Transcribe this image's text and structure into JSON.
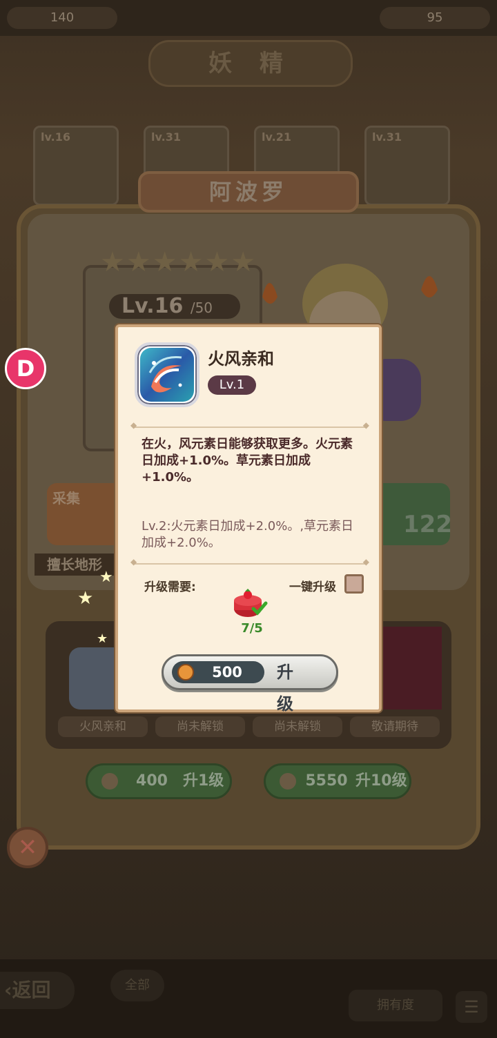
{
  "resources": {
    "left_value": "140",
    "right_value": "95"
  },
  "page_title": "妖 精",
  "hero_cards": [
    "lv.16",
    "lv.31",
    "lv.21",
    "lv.31"
  ],
  "hero_name": "阿波罗",
  "hero_level": {
    "current": "Lv.16",
    "max": "/50"
  },
  "hero_stars": 6,
  "background_panel": {
    "stat_left_label": "采集",
    "stat_right_value": "122",
    "sub_label": "擅长地形",
    "skill_labels": [
      "火风亲和",
      "尚未解锁",
      "尚未解锁",
      "敬请期待"
    ],
    "upgrade1": {
      "cost": "400",
      "label": "升1级"
    },
    "upgrade10": {
      "cost": "5550",
      "label": "升10级"
    }
  },
  "bottom_nav": {
    "back": "返回",
    "all": "全部",
    "owned": "拥有度"
  },
  "popup": {
    "skill_name": "火风亲和",
    "skill_level": "Lv.1",
    "description": "在火，风元素日能够获取更多。火元素日加成+1.0%。草元素日加成+1.0%。",
    "next_level": "Lv.2:火元素日加成+2.0%。,草元素日加成+2.0%。",
    "requirement_label": "升级需要:",
    "one_click_label": "一键升级",
    "one_click_checked": false,
    "material_count": "7/5",
    "upgrade_cost": "500",
    "upgrade_label": "升 级"
  },
  "colors": {
    "popup_bg": "#fbf0dd",
    "level_badge": "#5b3a46",
    "success_green": "#3a8a2a",
    "coin": "#e8953a"
  }
}
